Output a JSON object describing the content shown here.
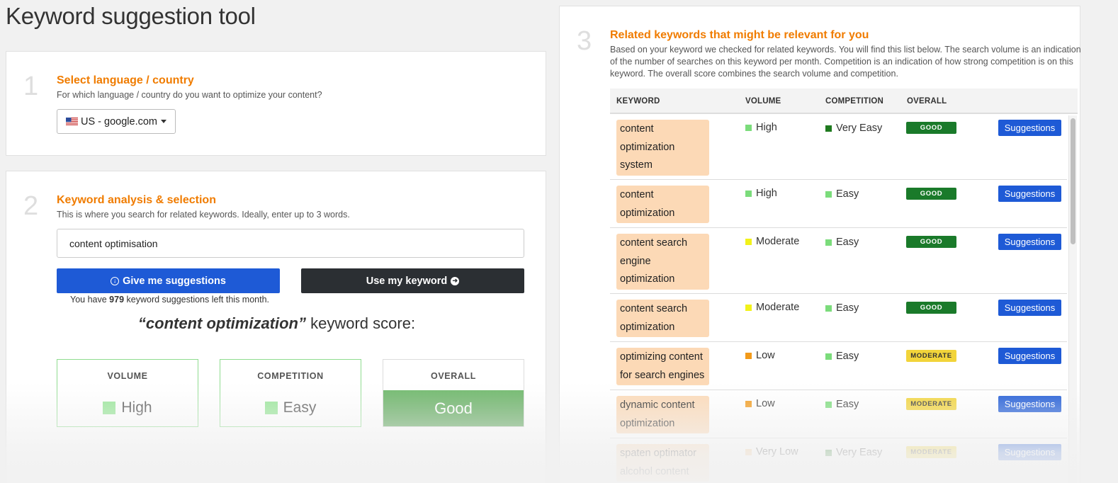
{
  "page": {
    "title": "Keyword suggestion tool"
  },
  "step1": {
    "number": "1",
    "title": "Select language / country",
    "description": "For which language / country do you want to optimize your content?",
    "selected_country": "US - google.com"
  },
  "step2": {
    "number": "2",
    "title": "Keyword analysis & selection",
    "description": "This is where you search for related keywords. Ideally, enter up to 3 words.",
    "input_value": "content optimisation",
    "suggest_button": "Give me suggestions",
    "use_button": "Use my keyword",
    "remaining_prefix": "You have",
    "remaining_count": "979",
    "remaining_suffix": "keyword suggestions left this month.",
    "score_keyword": "“content optimization”",
    "score_suffix": "keyword score:",
    "boxes": {
      "volume_label": "VOLUME",
      "volume_value": "High",
      "competition_label": "COMPETITION",
      "competition_value": "Easy",
      "overall_label": "OVERALL",
      "overall_value": "Good"
    }
  },
  "step3": {
    "number": "3",
    "title": "Related keywords that might be relevant for you",
    "description": "Based on your keyword we checked for related keywords. You will find this list below. The search volume is an indication of the number of searches on this keyword per month. Competition is an indication of how strong competition is on this keyword. The overall score combines the search volume and competition.",
    "columns": {
      "keyword": "KEYWORD",
      "volume": "VOLUME",
      "competition": "COMPETITION",
      "overall": "OVERALL"
    },
    "suggestions_label": "Suggestions",
    "rows": [
      {
        "keyword": "content optimization system",
        "volume": "High",
        "volume_color": "#7bdc7b",
        "competition": "Very Easy",
        "competition_color": "#1f7a1f",
        "overall": "GOOD"
      },
      {
        "keyword": "content optimization",
        "volume": "High",
        "volume_color": "#7bdc7b",
        "competition": "Easy",
        "competition_color": "#7bdc7b",
        "overall": "GOOD"
      },
      {
        "keyword": "content search engine optimization",
        "volume": "Moderate",
        "volume_color": "#f2f21a",
        "competition": "Easy",
        "competition_color": "#7bdc7b",
        "overall": "GOOD"
      },
      {
        "keyword": "content search optimization",
        "volume": "Moderate",
        "volume_color": "#f2f21a",
        "competition": "Easy",
        "competition_color": "#7bdc7b",
        "overall": "GOOD"
      },
      {
        "keyword": "optimizing content for search engines",
        "volume": "Low",
        "volume_color": "#f29a1a",
        "competition": "Easy",
        "competition_color": "#7bdc7b",
        "overall": "MODERATE"
      },
      {
        "keyword": "dynamic content optimization",
        "volume": "Low",
        "volume_color": "#f29a1a",
        "competition": "Easy",
        "competition_color": "#7bdc7b",
        "overall": "MODERATE"
      },
      {
        "keyword": "spaten optimator alcohol content",
        "volume": "Very Low",
        "volume_color": "#f5c48a",
        "competition": "Very Easy",
        "competition_color": "#1f7a1f",
        "overall": "MODERATE"
      }
    ]
  },
  "colors": {
    "accent_orange": "#f07c00",
    "primary_blue": "#1e5ad6",
    "dark_button": "#2b2f33",
    "good_badge": "#1a7a2a",
    "moderate_badge": "#f2d43a"
  }
}
